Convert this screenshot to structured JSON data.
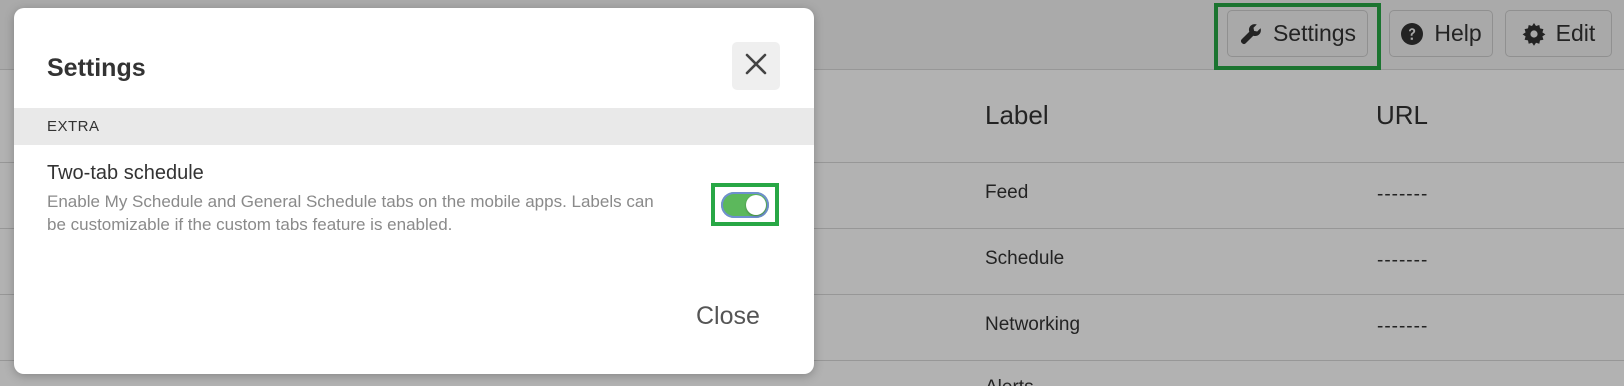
{
  "toolbar": {
    "settings_label": "Settings",
    "help_label": "Help",
    "edit_label": "Edit"
  },
  "table": {
    "headers": {
      "label": "Label",
      "url": "URL"
    },
    "rows": [
      {
        "label": "Feed",
        "url": "-------"
      },
      {
        "label": "Schedule",
        "url": "-------"
      },
      {
        "label": "Networking",
        "url": "-------"
      },
      {
        "label": "Alerts",
        "url": ""
      }
    ]
  },
  "modal": {
    "title": "Settings",
    "section": "EXTRA",
    "setting": {
      "name": "Two-tab schedule",
      "description": "Enable My Schedule and General Schedule tabs on the mobile apps. Labels can be customizable if the custom tabs feature is enabled.",
      "enabled": true
    },
    "close_label": "Close"
  },
  "colors": {
    "highlight": "#28a745",
    "toggle_on": "#5cb85c"
  },
  "icons": {
    "settings": "wrench-icon",
    "help": "question-circle-icon",
    "edit": "gear-icon",
    "close": "close-icon"
  }
}
